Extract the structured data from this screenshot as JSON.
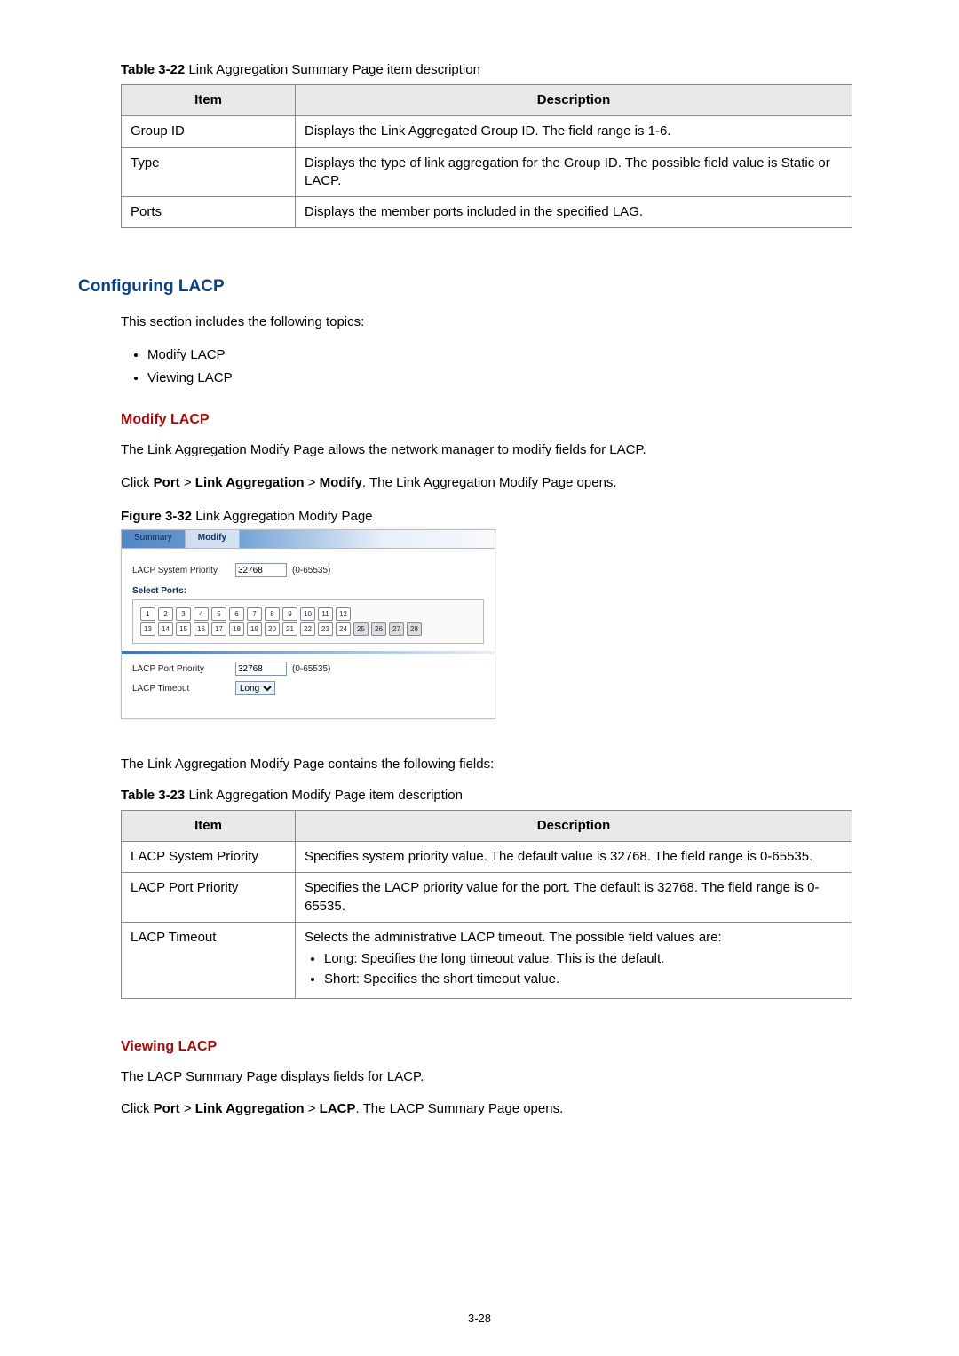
{
  "table22": {
    "caption_label": "Table 3-22",
    "caption_text": "Link Aggregation Summary Page item description",
    "headers": {
      "item": "Item",
      "desc": "Description"
    },
    "rows": [
      {
        "item": "Group ID",
        "desc": "Displays the Link Aggregated Group ID. The field range is 1-6."
      },
      {
        "item": "Type",
        "desc": "Displays the type of link aggregation for the Group ID. The possible field value is Static or LACP."
      },
      {
        "item": "Ports",
        "desc": "Displays the member ports included in the specified LAG."
      }
    ]
  },
  "section_heading": "Configuring LACP",
  "intro_text": "This section includes the following topics:",
  "intro_bullets": [
    "Modify LACP",
    "Viewing LACP"
  ],
  "modify": {
    "heading": "Modify LACP",
    "para1": "The Link Aggregation Modify Page allows the network manager to modify fields for LACP.",
    "click_pre": "Click ",
    "click_b1": "Port",
    "click_sep": " > ",
    "click_b2": "Link Aggregation",
    "click_b3": "Modify",
    "click_post": ". The Link Aggregation Modify Page opens.",
    "fig_label": "Figure 3-32",
    "fig_text": "Link Aggregation Modify Page",
    "contains_text": "The Link Aggregation Modify Page contains the following fields:"
  },
  "screenshot": {
    "tabs": {
      "summary": "Summary",
      "modify": "Modify"
    },
    "sys_priority_label": "LACP System Priority",
    "sys_priority_value": "32768",
    "sys_priority_hint": "(0-65535)",
    "select_ports_label": "Select Ports:",
    "ports_top": [
      "1",
      "2",
      "3",
      "4",
      "5",
      "6",
      "7",
      "8",
      "9",
      "10",
      "11",
      "12"
    ],
    "ports_bottom": [
      "13",
      "14",
      "15",
      "16",
      "17",
      "18",
      "19",
      "20",
      "21",
      "22",
      "23",
      "24",
      "25",
      "26",
      "27",
      "28"
    ],
    "port_priority_label": "LACP Port Priority",
    "port_priority_value": "32768",
    "port_priority_hint": "(0-65535)",
    "timeout_label": "LACP Timeout",
    "timeout_value": "Long"
  },
  "table23": {
    "caption_label": "Table 3-23",
    "caption_text": "Link Aggregation Modify Page item description",
    "headers": {
      "item": "Item",
      "desc": "Description"
    },
    "rows": [
      {
        "item": "LACP System Priority",
        "desc": "Specifies system priority value. The default value is 32768. The field range is 0-65535."
      },
      {
        "item": "LACP Port Priority",
        "desc": "Specifies the LACP priority value for the port. The default is 32768. The field range is 0-65535."
      },
      {
        "item": "LACP Timeout",
        "desc_intro": "Selects the administrative LACP timeout. The possible field values are:",
        "desc_bullets": [
          "Long: Specifies the long timeout value. This is the default.",
          "Short: Specifies the short timeout value."
        ]
      }
    ]
  },
  "viewing": {
    "heading": "Viewing LACP",
    "para1": "The LACP Summary Page displays fields for LACP.",
    "click_pre": "Click ",
    "click_b1": "Port",
    "click_sep": " > ",
    "click_b2": "Link Aggregation",
    "click_b3": "LACP",
    "click_post": ". The LACP Summary Page opens."
  },
  "page_number": "3-28",
  "chart_data": [
    {
      "type": "table",
      "title": "Table 3-22 Link Aggregation Summary Page item description",
      "columns": [
        "Item",
        "Description"
      ],
      "rows": [
        [
          "Group ID",
          "Displays the Link Aggregated Group ID. The field range is 1-6."
        ],
        [
          "Type",
          "Displays the type of link aggregation for the Group ID. The possible field value is Static or LACP."
        ],
        [
          "Ports",
          "Displays the member ports included in the specified LAG."
        ]
      ]
    },
    {
      "type": "table",
      "title": "Table 3-23 Link Aggregation Modify Page item description",
      "columns": [
        "Item",
        "Description"
      ],
      "rows": [
        [
          "LACP System Priority",
          "Specifies system priority value. The default value is 32768. The field range is 0-65535."
        ],
        [
          "LACP Port Priority",
          "Specifies the LACP priority value for the port. The default is 32768. The field range is 0-65535."
        ],
        [
          "LACP Timeout",
          "Selects the administrative LACP timeout. The possible field values are: Long: Specifies the long timeout value. This is the default. Short: Specifies the short timeout value."
        ]
      ]
    }
  ]
}
